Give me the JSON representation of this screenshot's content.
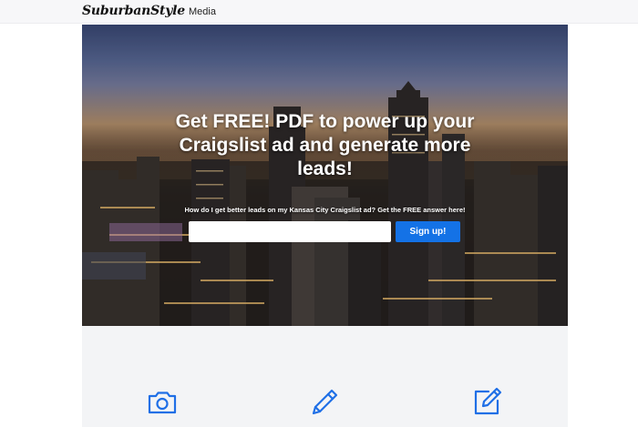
{
  "header": {
    "brand_script": "SuburbanStyle",
    "brand_text": "Media"
  },
  "hero": {
    "headline": "Get FREE! PDF to power up your Craigslist ad and generate more leads!",
    "subline": "How do I get better leads on my Kansas City Craigslist ad? Get the FREE answer here!",
    "email_value": "",
    "email_placeholder": "",
    "signup_label": "Sign up!"
  },
  "features": {
    "icons": [
      "camera-icon",
      "pencil-icon",
      "edit-square-icon"
    ]
  },
  "colors": {
    "accent": "#1472e6",
    "icon": "#1f6fe6",
    "section_bg": "#f3f4f6",
    "topbar_bg": "#f7f7f9"
  }
}
